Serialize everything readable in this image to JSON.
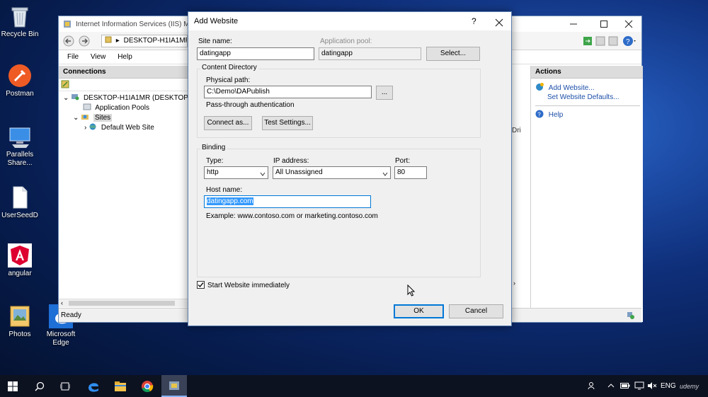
{
  "desktop": {
    "icons": [
      {
        "label": "Recycle Bin"
      },
      {
        "label": "Postman"
      },
      {
        "label": "Parallels Share..."
      },
      {
        "label": "UserSeedD"
      },
      {
        "label": "angular"
      },
      {
        "label": "Photos"
      },
      {
        "label": "Microsoft Edge"
      }
    ]
  },
  "iis": {
    "title": "Internet Information Services (IIS) Mana",
    "address": "DESKTOP-H1IA1MR",
    "menu": [
      "File",
      "View",
      "Help"
    ],
    "connections": {
      "title": "Connections",
      "tree": [
        "DESKTOP-H1IA1MR (DESKTOP-H1IA",
        "Application Pools",
        "Sites",
        "Default Web Site"
      ]
    },
    "actions": {
      "title": "Actions",
      "add_website": "Add Website...",
      "set_defaults": "Set Website Defaults...",
      "help": "Help"
    },
    "background_fragment": "Dri",
    "status": "Ready"
  },
  "dialog": {
    "title": "Add Website",
    "help_glyph": "?",
    "site_name_label": "Site name:",
    "site_name_value": "datingapp",
    "app_pool_label": "Application pool:",
    "app_pool_value": "datingapp",
    "select_button": "Select...",
    "content_dir_title": "Content Directory",
    "physical_path_label": "Physical path:",
    "physical_path_value": "C:\\Demo\\DAPublish",
    "browse_button": "...",
    "passthrough_label": "Pass-through authentication",
    "connect_button": "Connect as...",
    "test_button": "Test Settings...",
    "binding_title": "Binding",
    "type_label": "Type:",
    "type_value": "http",
    "ip_label": "IP address:",
    "ip_value": "All Unassigned",
    "port_label": "Port:",
    "port_value": "80",
    "host_label": "Host name:",
    "host_value": "datingapp.com",
    "example_text": "Example: www.contoso.com or marketing.contoso.com",
    "start_immediately_label": "Start Website immediately",
    "start_immediately_checked": true,
    "ok_button": "OK",
    "cancel_button": "Cancel"
  },
  "taskbar": {
    "language": "ENG",
    "watermark": "udemy"
  },
  "colors": {
    "accent": "#0078d7",
    "link": "#1c4fa8",
    "selection": "#3399ff"
  }
}
